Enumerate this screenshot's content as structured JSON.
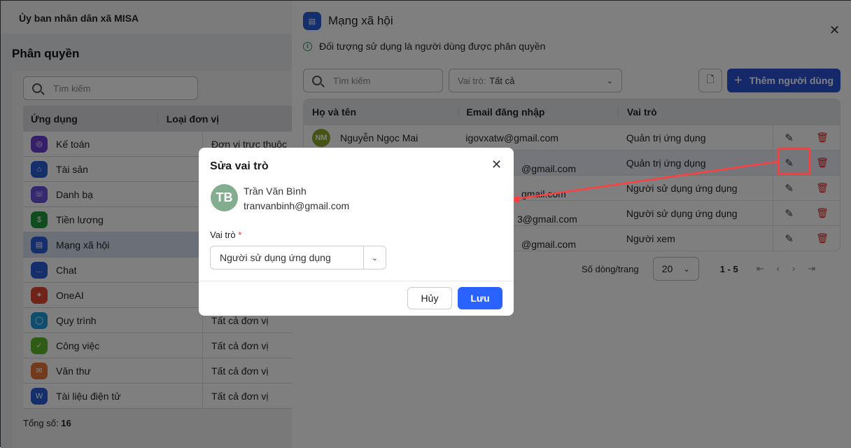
{
  "org_name": "Ủy ban nhân dân xã MISA",
  "page_title": "Phân quyền",
  "left_search_placeholder": "Tìm kiếm",
  "left_table": {
    "headers": [
      "Ứng dụng",
      "Loại đơn vị"
    ],
    "rows": [
      {
        "app": "Kế toán",
        "unit": "Đơn vị trực thuộc",
        "color": "#6a3fd0"
      },
      {
        "app": "Tài sản",
        "unit": "",
        "color": "#2b5fd9"
      },
      {
        "app": "Danh bạ",
        "unit": "",
        "color": "#6a4fe0"
      },
      {
        "app": "Tiền lương",
        "unit": "",
        "color": "#1e9a3a"
      },
      {
        "app": "Mạng xã hội",
        "unit": "",
        "color": "#2b5fd9",
        "selected": true
      },
      {
        "app": "Chat",
        "unit": "",
        "color": "#2b5fd9"
      },
      {
        "app": "OneAI",
        "unit": "",
        "color": "#e0482f"
      },
      {
        "app": "Quy trình",
        "unit": "Tất cả đơn vị",
        "color": "#1c9ad6"
      },
      {
        "app": "Công việc",
        "unit": "Tất cả đơn vị",
        "color": "#5cb82a"
      },
      {
        "app": "Văn thư",
        "unit": "Tất cả đơn vị",
        "color": "#e8743a"
      },
      {
        "app": "Tài liệu điện tử",
        "unit": "Tất cả đơn vị",
        "color": "#2b5fd9"
      }
    ]
  },
  "total_label": "Tổng số:",
  "total_value": "16",
  "drawer": {
    "title": "Mạng xã hội",
    "info": "Đối tượng sử dụng là người dùng được phân quyền",
    "search_placeholder": "Tìm kiếm",
    "role_filter_label": "Vai trò:",
    "role_filter_value": "Tất cả",
    "add_button": "Thêm người dùng",
    "table": {
      "headers": [
        "Họ và tên",
        "Email đăng nhập",
        "Vai trò"
      ],
      "rows": [
        {
          "initials": "NM",
          "name": "Nguyễn Ngọc Mai",
          "email": "igovxatw@gmail.com",
          "role": "Quản trị ứng dụng"
        },
        {
          "initials": "",
          "name": "",
          "email": "@gmail.com",
          "role": "Quản trị ứng dụng"
        },
        {
          "initials": "",
          "name": "",
          "email": "gmail.com",
          "role": "Người sử dụng ứng dụng"
        },
        {
          "initials": "",
          "name": "",
          "email": "3@gmail.com",
          "role": "Người sử dụng ứng dụng"
        },
        {
          "initials": "",
          "name": "",
          "email": "@gmail.com",
          "role": "Người xem"
        }
      ]
    },
    "rows_per_page_label": "Số dòng/trang",
    "rows_per_page": "20",
    "range": "1 - 5"
  },
  "modal": {
    "title": "Sửa vai trò",
    "initials": "TB",
    "name": "Trần Văn Bình",
    "email": "tranvanbinh@gmail.com",
    "role_label": "Vai trò",
    "required_mark": "*",
    "role_value": "Người sử dụng ứng dụng",
    "cancel": "Hủy",
    "save": "Lưu"
  },
  "colors": {
    "primary": "#2962ff",
    "highlight": "#ff3b3b"
  }
}
